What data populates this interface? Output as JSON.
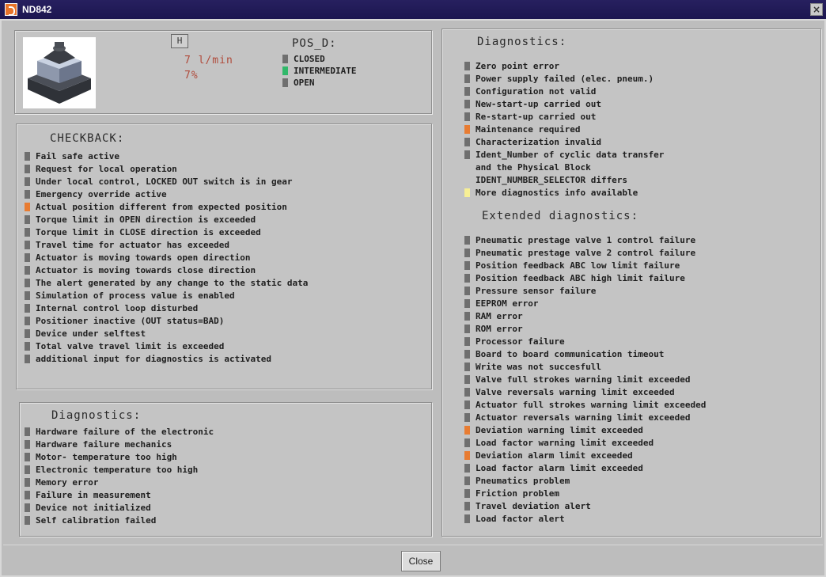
{
  "window": {
    "title": "ND842",
    "close_glyph": "×"
  },
  "status": {
    "mode": "H",
    "flow": "7 l/min",
    "percent": "7%",
    "pos_title": "POS_D:",
    "pos_items": [
      {
        "label": "CLOSED",
        "color": "#6f6f6f"
      },
      {
        "label": "INTERMEDIATE",
        "color": "#31b86a"
      },
      {
        "label": "OPEN",
        "color": "#6f6f6f"
      }
    ]
  },
  "checkback": {
    "title": "CHECKBACK:",
    "items": [
      {
        "text": "Fail safe active",
        "state": "normal"
      },
      {
        "text": "Request for local operation",
        "state": "normal"
      },
      {
        "text": "Under local control, LOCKED OUT switch is in gear",
        "state": "normal"
      },
      {
        "text": "Emergency override active",
        "state": "normal"
      },
      {
        "text": "Actual position different from expected position",
        "state": "alert"
      },
      {
        "text": "Torque limit in OPEN direction is exceeded",
        "state": "normal"
      },
      {
        "text": "Torque limit in CLOSE direction is exceeded",
        "state": "normal"
      },
      {
        "text": "Travel time for actuator has exceeded",
        "state": "normal"
      },
      {
        "text": "Actuator is moving towards open direction",
        "state": "normal"
      },
      {
        "text": "Actuator is moving towards close direction",
        "state": "normal"
      },
      {
        "text": "The alert generated by any change to the static data",
        "state": "normal"
      },
      {
        "text": "Simulation of process value is enabled",
        "state": "normal"
      },
      {
        "text": "Internal control loop disturbed",
        "state": "normal"
      },
      {
        "text": "Positioner inactive (OUT status=BAD)",
        "state": "normal"
      },
      {
        "text": "Device under selftest",
        "state": "normal"
      },
      {
        "text": "Total valve travel limit is exceeded",
        "state": "normal"
      },
      {
        "text": "additional input for diagnostics is activated",
        "state": "normal"
      }
    ]
  },
  "diag_left": {
    "title": "Diagnostics:",
    "items": [
      {
        "text": "Hardware failure of the electronic",
        "state": "normal"
      },
      {
        "text": "Hardware failure mechanics",
        "state": "normal"
      },
      {
        "text": "Motor- temperature too high",
        "state": "normal"
      },
      {
        "text": "Electronic temperature too high",
        "state": "normal"
      },
      {
        "text": "Memory error",
        "state": "normal"
      },
      {
        "text": "Failure in measurement",
        "state": "normal"
      },
      {
        "text": "Device not initialized",
        "state": "normal"
      },
      {
        "text": "Self calibration failed",
        "state": "normal"
      }
    ]
  },
  "diag_right": {
    "title": "Diagnostics:",
    "items": [
      {
        "text": "Zero point error",
        "state": "normal"
      },
      {
        "text": "Power supply failed (elec. pneum.)",
        "state": "normal"
      },
      {
        "text": "Configuration not valid",
        "state": "normal"
      },
      {
        "text": "New-start-up carried out",
        "state": "normal"
      },
      {
        "text": "Re-start-up carried out",
        "state": "normal"
      },
      {
        "text": "Maintenance required",
        "state": "alert"
      },
      {
        "text": "Characterization invalid",
        "state": "normal"
      },
      {
        "text": "Ident_Number of cyclic data transfer",
        "state": "normal"
      },
      {
        "text": "and the Physical Block",
        "state": "none"
      },
      {
        "text": "IDENT_NUMBER_SELECTOR differs",
        "state": "none"
      },
      {
        "text": "More diagnostics info available",
        "state": "info"
      }
    ]
  },
  "extended": {
    "title": "Extended diagnostics:",
    "items": [
      {
        "text": "Pneumatic prestage valve 1 control failure",
        "state": "normal"
      },
      {
        "text": "Pneumatic prestage valve 2 control failure",
        "state": "normal"
      },
      {
        "text": "Position feedback ABC low limit failure",
        "state": "normal"
      },
      {
        "text": "Position feedback ABC high limit failure",
        "state": "normal"
      },
      {
        "text": "Pressure sensor failure",
        "state": "normal"
      },
      {
        "text": "EEPROM error",
        "state": "normal"
      },
      {
        "text": "RAM error",
        "state": "normal"
      },
      {
        "text": "ROM error",
        "state": "normal"
      },
      {
        "text": "Processor failure",
        "state": "normal"
      },
      {
        "text": "Board to board communication timeout",
        "state": "normal"
      },
      {
        "text": "Write was not succesfull",
        "state": "normal"
      },
      {
        "text": "Valve full strokes warning limit exceeded",
        "state": "normal"
      },
      {
        "text": "Valve reversals warning limit exceeded",
        "state": "normal"
      },
      {
        "text": "Actuator full strokes warning limit exceeded",
        "state": "normal"
      },
      {
        "text": "Actuator reversals warning limit exceeded",
        "state": "normal"
      },
      {
        "text": "Deviation warning limit exceeded",
        "state": "alert"
      },
      {
        "text": "Load factor warning limit exceeded",
        "state": "normal"
      },
      {
        "text": "Deviation alarm limit exceeded",
        "state": "alert"
      },
      {
        "text": "Load factor alarm limit exceeded",
        "state": "normal"
      },
      {
        "text": "Pneumatics problem",
        "state": "normal"
      },
      {
        "text": "Friction problem",
        "state": "normal"
      },
      {
        "text": "Travel deviation alert",
        "state": "normal"
      },
      {
        "text": "Load factor alert",
        "state": "normal"
      }
    ]
  },
  "footer": {
    "close_label": "Close"
  },
  "colors": {
    "title_bar": "#1c1650",
    "alert": "#e87c32",
    "info": "#f7ef95",
    "active": "#31b86a",
    "inactive": "#6f6f6f"
  }
}
